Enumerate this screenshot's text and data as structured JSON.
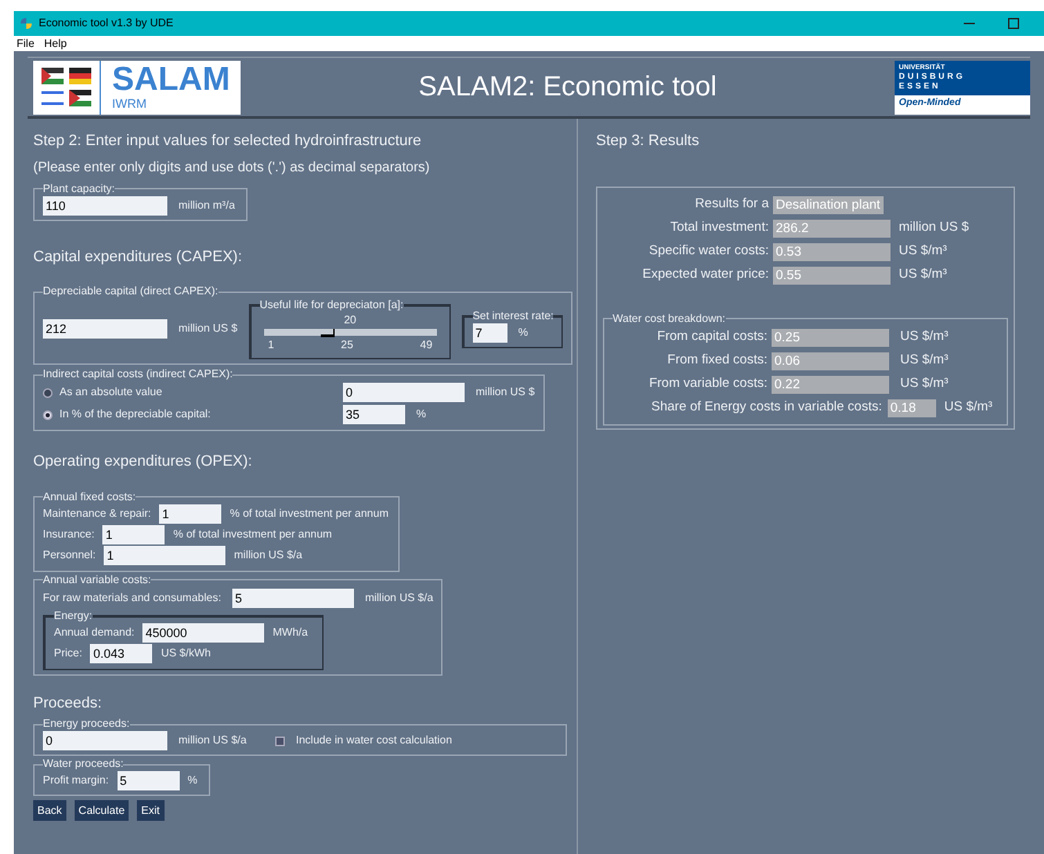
{
  "window": {
    "title": "Economic tool v1.3 by UDE"
  },
  "menu": [
    "File",
    "Help"
  ],
  "header": {
    "logo_name": "SALAM",
    "logo_sub": "IWRM",
    "title": "SALAM2: Economic tool",
    "uni_logo": {
      "top": "UNIVERSITÄT",
      "upper": "DUISBURG",
      "lower": "ESSEN",
      "tagline": "Open-Minded"
    }
  },
  "input": {
    "title": "Step 2: Enter input values for selected hydroinfrastructure",
    "hint": "(Please enter only digits and use dots ('.') as decimal separators)",
    "plant_capacity": {
      "legend": "Plant capacity:",
      "value": "110",
      "unit": "million m³/a"
    },
    "capex_heading": "Capital expenditures (CAPEX):",
    "depreciable": {
      "legend": "Depreciable capital (direct CAPEX):",
      "value": "212",
      "unit": "million US $",
      "useful_life": {
        "legend": "Useful life for depreciaton [a]:",
        "reading": "20",
        "level": 0.396,
        "ticks": [
          "1",
          "25",
          "49"
        ]
      },
      "interest": {
        "legend": "Set interest rate:",
        "value": "7",
        "unit": "%"
      }
    },
    "indirect": {
      "legend": "Indirect capital costs (indirect CAPEX):",
      "options": [
        {
          "label": "As an absolute value",
          "selected": false,
          "value": "0",
          "unit": "million US $"
        },
        {
          "label": "In % of the depreciable capital:",
          "selected": true,
          "value": "35",
          "unit": "%"
        }
      ]
    },
    "opex_heading": "Operating expenditures (OPEX):",
    "fixed": {
      "legend": "Annual fixed costs:",
      "rows": [
        {
          "label": "Maintenance & repair:",
          "value": "1",
          "unit": "% of total investment per annum"
        },
        {
          "label": "Insurance:",
          "value": "1",
          "unit": "% of total investment per annum"
        },
        {
          "label": "Personnel:",
          "value": "1",
          "unit": "million US $/a"
        }
      ]
    },
    "variable": {
      "legend": "Annual variable costs:",
      "raw": {
        "label": "For raw materials and consumables:",
        "value": "5",
        "unit": "million US $/a"
      },
      "energy": {
        "legend": "Energy:",
        "rows": [
          {
            "label": "Annual demand:",
            "value": "450000",
            "unit": "MWh/a"
          },
          {
            "label": "Price:",
            "value": "0.043",
            "unit": "US $/kWh"
          }
        ]
      }
    },
    "proceeds_heading": "Proceeds:",
    "energy_proceeds": {
      "legend": "Energy proceeds:",
      "value": "0",
      "unit": "million US $/a",
      "include_label": "Include in water cost calculation",
      "checked": false
    },
    "water_proceeds": {
      "legend": "Water proceeds:",
      "label": "Profit margin:",
      "value": "5",
      "unit": "%"
    }
  },
  "buttons": [
    "Back",
    "Calculate",
    "Exit"
  ],
  "results": {
    "title": "Step 3: Results",
    "rows": [
      {
        "label": "Results for a",
        "value": "Desalination plant"
      },
      {
        "label": "Total investment:",
        "value": "286.2",
        "unit": "million US $"
      },
      {
        "label": "Specific water costs:",
        "value": "0.53",
        "unit": "US $/m³"
      },
      {
        "label": "Expected water price:",
        "value": "0.55",
        "unit": "US $/m³"
      }
    ],
    "breakdown": {
      "legend": "Water cost breakdown:",
      "rows": [
        {
          "label": "From capital costs:",
          "value": "0.25",
          "unit": "US $/m³"
        },
        {
          "label": "From fixed costs:",
          "value": "0.06",
          "unit": "US $/m³"
        },
        {
          "label": "From variable costs:",
          "value": "0.22",
          "unit": "US $/m³"
        }
      ],
      "share": {
        "label": "Share of Energy costs in variable costs:",
        "value": "0.18",
        "unit": "US $/m³"
      }
    }
  }
}
